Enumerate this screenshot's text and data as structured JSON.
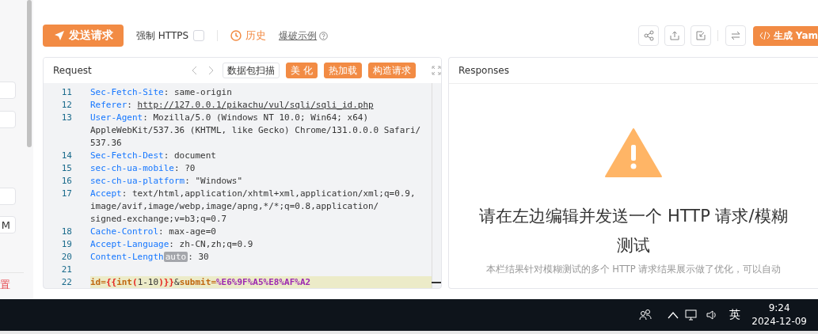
{
  "sidebar": {
    "fields": [
      {
        "kind": "input"
      },
      {
        "kind": "input"
      },
      {
        "kind": "input"
      },
      {
        "kind": "input",
        "value": "M"
      }
    ],
    "reset_link": "置"
  },
  "toolbar": {
    "send_button": "发送请求",
    "force_https": {
      "label": "强制 HTTPS",
      "checked": false
    },
    "history_link": "历史",
    "example_link": "爆破示例",
    "generate_button": "生成 Yam"
  },
  "request": {
    "title": "Request",
    "buttons": [
      {
        "label": "数据包扫描",
        "kind": "plain"
      },
      {
        "label": "美 化",
        "kind": "primary"
      },
      {
        "label": "热加载",
        "kind": "primary"
      },
      {
        "label": "构造请求",
        "kind": "primary"
      }
    ],
    "lines": [
      {
        "number": "11",
        "kind": "header",
        "key": "Sec-Fetch-Site",
        "sep": ":",
        "value": "same-origin"
      },
      {
        "number": "12",
        "kind": "header",
        "key": "Referer",
        "sep": ":",
        "value": "http://127.0.0.1/pikachu/vul/sqli/sqli_id.php",
        "link": true
      },
      {
        "number": "13",
        "kind": "header",
        "key": "User-Agent",
        "sep": ":",
        "value": "Mozilla/5.0 (Windows NT 10.0; Win64; x64)",
        "more": [
          "AppleWebKit/537.36 (KHTML, like Gecko) Chrome/131.0.0.0 Safari/",
          "537.36"
        ]
      },
      {
        "number": "14",
        "kind": "header",
        "key": "Sec-Fetch-Dest",
        "sep": ":",
        "value": "document"
      },
      {
        "number": "15",
        "kind": "header",
        "key": "sec-ch-ua-mobile",
        "sep": ":",
        "value": "?0"
      },
      {
        "number": "16",
        "kind": "header",
        "key": "sec-ch-ua-platform",
        "sep": ":",
        "value": "\"Windows\""
      },
      {
        "number": "17",
        "kind": "header",
        "key": "Accept",
        "sep": ":",
        "value": "text/html,application/xhtml+xml,application/xml;q=0.9,",
        "more": [
          "image/avif,image/webp,image/apng,*/*;q=0.8,application/",
          "signed-exchange;v=b3;q=0.7"
        ]
      },
      {
        "number": "18",
        "kind": "header",
        "key": "Cache-Control",
        "sep": ":",
        "value": "max-age=0"
      },
      {
        "number": "19",
        "kind": "header",
        "key": "Accept-Language",
        "sep": ":",
        "value": "zh-CN,zh;q=0.9"
      },
      {
        "number": "20",
        "kind": "header",
        "key": "Content-Length",
        "badge": "auto",
        "sep": ":",
        "value": "30"
      },
      {
        "number": "21",
        "kind": "blank"
      },
      {
        "number": "22",
        "kind": "body",
        "current": true,
        "tokens": [
          {
            "text": "id",
            "kind": "param"
          },
          {
            "text": "=",
            "kind": "op"
          },
          {
            "text": "{{",
            "kind": "brace"
          },
          {
            "text": "int",
            "kind": "param"
          },
          {
            "text": "(",
            "kind": "brace"
          },
          {
            "text": "1-10",
            "kind": "plain"
          },
          {
            "text": ")}}",
            "kind": "brace"
          },
          {
            "text": "&",
            "kind": "plain"
          },
          {
            "text": "submit",
            "kind": "param"
          },
          {
            "text": "=",
            "kind": "op"
          },
          {
            "text": "%E6%9F%A5%E8%AF%A2",
            "kind": "value"
          }
        ]
      }
    ]
  },
  "responses": {
    "title": "Responses",
    "heading": "请在左边编辑并发送一个 HTTP 请求/模糊测试",
    "description": "本栏结果针对模糊测试的多个 HTTP 请求结果展示做了优化，可以自动"
  },
  "taskbar": {
    "input_method": "英",
    "time": "9:24",
    "date": "2024-12-09"
  }
}
